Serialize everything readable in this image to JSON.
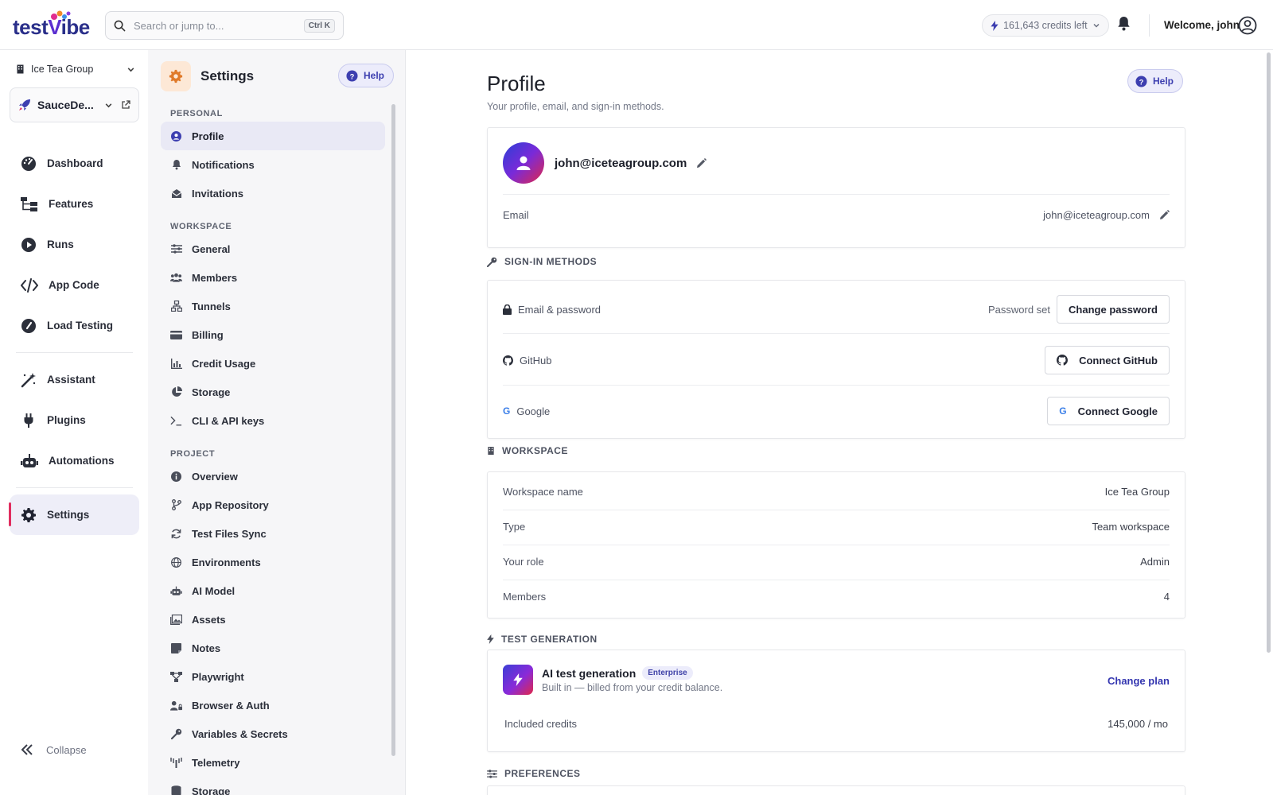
{
  "brand": {
    "logo_text_a": "test",
    "logo_text_b": "ibe"
  },
  "search": {
    "placeholder": "Search or jump to...",
    "shortcut": "Ctrl K"
  },
  "header": {
    "credits": "161,643 credits left",
    "welcome": "Welcome, john"
  },
  "leftnav": {
    "org": "Ice Tea Group",
    "project": "SauceDe...",
    "items": [
      "Dashboard",
      "Features",
      "Runs",
      "App Code",
      "Load Testing",
      "Assistant",
      "Plugins",
      "Automations",
      "Settings"
    ],
    "collapse": "Collapse"
  },
  "settings": {
    "title": "Settings",
    "help": "Help",
    "sections": {
      "personal": "PERSONAL",
      "workspace": "WORKSPACE",
      "project": "PROJECT"
    },
    "personal": [
      "Profile",
      "Notifications",
      "Invitations"
    ],
    "workspace": [
      "General",
      "Members",
      "Tunnels",
      "Billing",
      "Credit Usage",
      "Storage",
      "CLI & API keys"
    ],
    "project": [
      "Overview",
      "App Repository",
      "Test Files Sync",
      "Environments",
      "AI Model",
      "Assets",
      "Notes",
      "Playwright",
      "Browser & Auth",
      "Variables & Secrets",
      "Telemetry",
      "Storage"
    ]
  },
  "profile": {
    "title": "Profile",
    "subtitle": "Your profile, email, and sign-in methods.",
    "help": "Help",
    "email_display": "john@iceteagroup.com",
    "email_label": "Email",
    "email_value": "john@iceteagroup.com"
  },
  "signin": {
    "heading": "SIGN-IN METHODS",
    "email_pw_label": "Email & password",
    "password_status": "Password set",
    "change_password": "Change password",
    "github_label": "GitHub",
    "connect_github": "Connect GitHub",
    "google_label": "Google",
    "connect_google": "Connect Google",
    "google_glyph": "G"
  },
  "workspace": {
    "heading": "WORKSPACE",
    "rows": [
      {
        "label": "Workspace name",
        "value": "Ice Tea Group"
      },
      {
        "label": "Type",
        "value": "Team workspace"
      },
      {
        "label": "Your role",
        "value": "Admin"
      },
      {
        "label": "Members",
        "value": "4"
      }
    ]
  },
  "testgen": {
    "heading": "TEST GENERATION",
    "title": "AI test generation",
    "badge": "Enterprise",
    "subtitle": "Built in — billed from your credit balance.",
    "change_plan": "Change plan",
    "credits_label": "Included credits",
    "credits_value": "145,000 / mo"
  },
  "preferences": {
    "heading": "PREFERENCES"
  },
  "colors": {
    "accent": "#3d3fb0",
    "active_marker": "#e02d5f",
    "settings_icon_bg": "#fde8d6"
  }
}
